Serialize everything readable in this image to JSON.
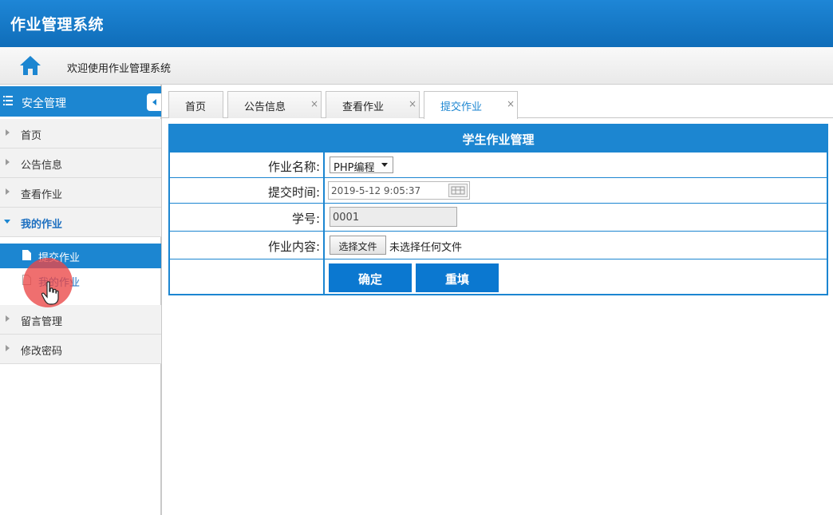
{
  "app": {
    "title": "作业管理系统"
  },
  "welcome": {
    "text": "欢迎使用作业管理系统",
    "icon": "home-icon"
  },
  "sidebar": {
    "header": "安全管理",
    "items": [
      {
        "label": "首页"
      },
      {
        "label": "公告信息"
      },
      {
        "label": "查看作业"
      },
      {
        "label": "我的作业",
        "expanded": true
      },
      {
        "label": "留言管理"
      },
      {
        "label": "修改密码"
      }
    ],
    "sub_items": [
      {
        "label": "提交作业",
        "active": true
      },
      {
        "label": "我的作业"
      }
    ]
  },
  "tabs": [
    {
      "label": "首页",
      "closable": false
    },
    {
      "label": "公告信息",
      "closable": true,
      "close": "×"
    },
    {
      "label": "查看作业",
      "closable": true,
      "close": "×"
    },
    {
      "label": "提交作业",
      "closable": true,
      "close": "×",
      "active": true
    }
  ],
  "form": {
    "title": "学生作业管理",
    "fields": {
      "name": {
        "label": "作业名称:",
        "value": "PHP编程"
      },
      "time": {
        "label": "提交时间:",
        "value": "2019-5-12 9:05:37"
      },
      "student_id": {
        "label": "学号:",
        "value": "0001"
      },
      "content": {
        "label": "作业内容:",
        "button": "选择文件",
        "status": "未选择任何文件"
      }
    },
    "buttons": {
      "confirm": "确定",
      "reset": "重填"
    }
  },
  "colors": {
    "primary": "#1c86d1",
    "header_bg": "#1479c8",
    "button": "#0b78d0",
    "cursor_highlight": "#eb4646"
  }
}
